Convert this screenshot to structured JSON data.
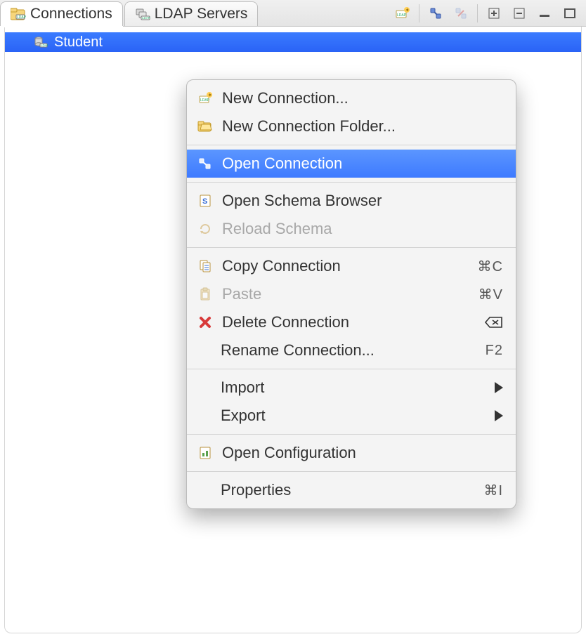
{
  "tabs": {
    "connections": {
      "label": "Connections"
    },
    "ldap_servers": {
      "label": "LDAP Servers"
    }
  },
  "tree": {
    "items": [
      {
        "label": "Student"
      }
    ]
  },
  "menu": {
    "new_connection": {
      "label": "New Connection..."
    },
    "new_folder": {
      "label": "New Connection Folder..."
    },
    "open_connection": {
      "label": "Open Connection"
    },
    "open_schema_browser": {
      "label": "Open Schema Browser"
    },
    "reload_schema": {
      "label": "Reload Schema"
    },
    "copy_connection": {
      "label": "Copy Connection",
      "shortcut": "⌘C"
    },
    "paste": {
      "label": "Paste",
      "shortcut": "⌘V"
    },
    "delete_connection": {
      "label": "Delete Connection",
      "shortcut": "⌦"
    },
    "rename_connection": {
      "label": "Rename Connection...",
      "shortcut": "F2"
    },
    "import": {
      "label": "Import"
    },
    "export": {
      "label": "Export"
    },
    "open_configuration": {
      "label": "Open Configuration"
    },
    "properties": {
      "label": "Properties",
      "shortcut": "⌘I"
    }
  }
}
